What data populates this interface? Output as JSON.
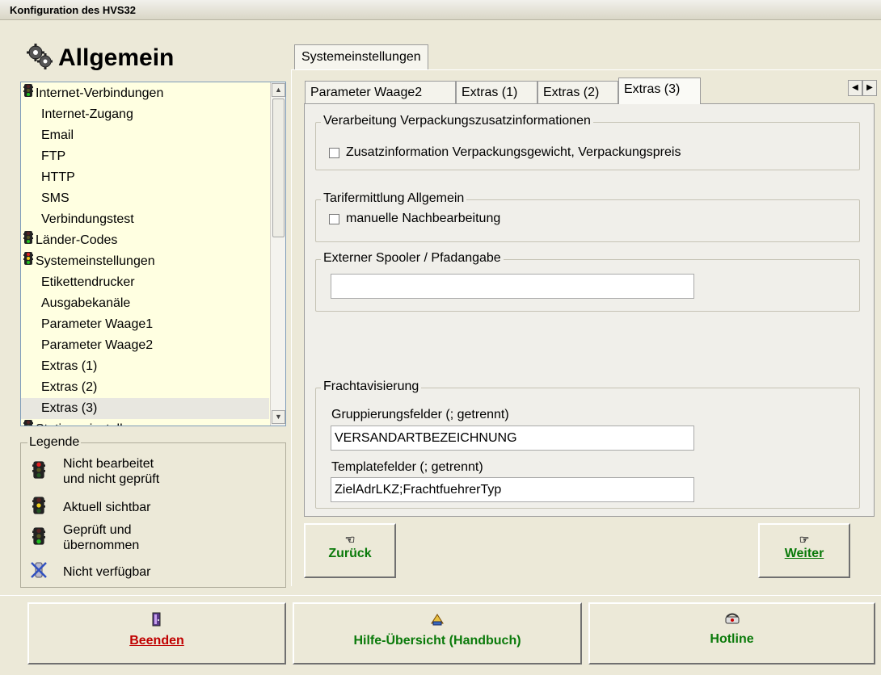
{
  "window": {
    "title": "Konfiguration des HVS32"
  },
  "left": {
    "heading": "Allgemein",
    "tree": [
      {
        "label": "Internet-Verbindungen",
        "level": 0,
        "icon": "traffic-light-icon"
      },
      {
        "label": "Internet-Zugang",
        "level": 1
      },
      {
        "label": "Email",
        "level": 1
      },
      {
        "label": "FTP",
        "level": 1
      },
      {
        "label": "HTTP",
        "level": 1
      },
      {
        "label": "SMS",
        "level": 1
      },
      {
        "label": "Verbindungstest",
        "level": 1
      },
      {
        "label": "Länder-Codes",
        "level": 0,
        "icon": "traffic-light-icon"
      },
      {
        "label": "Systemeinstellungen",
        "level": 0,
        "icon": "traffic-light-icon"
      },
      {
        "label": "Etikettendrucker",
        "level": 1
      },
      {
        "label": "Ausgabekanäle",
        "level": 1
      },
      {
        "label": "Parameter Waage1",
        "level": 1
      },
      {
        "label": "Parameter Waage2",
        "level": 1
      },
      {
        "label": "Extras (1)",
        "level": 1
      },
      {
        "label": "Extras (2)",
        "level": 1
      },
      {
        "label": "Extras (3)",
        "level": 1,
        "selected": true
      },
      {
        "label": "Stationseinstellungen",
        "level": 0,
        "icon": "traffic-light-icon"
      }
    ],
    "legend": {
      "title": "Legende",
      "items": [
        {
          "line1": "Nicht bearbeitet",
          "line2": "und nicht geprüft",
          "icon": "traffic-light-red-icon"
        },
        {
          "line1": "Aktuell sichtbar",
          "line2": "",
          "icon": "traffic-light-yellow-icon"
        },
        {
          "line1": "Geprüft und",
          "line2": "übernommen",
          "icon": "traffic-light-green-icon"
        },
        {
          "line1": "Nicht verfügbar",
          "line2": "",
          "icon": "not-available-icon"
        }
      ]
    }
  },
  "main": {
    "main_tab": "Systemeinstellungen",
    "sub_tabs": [
      "Parameter Waage2",
      "Extras (1)",
      "Extras (2)",
      "Extras (3)"
    ],
    "active_sub_tab": "Extras (3)",
    "groups": {
      "verpackung": {
        "title": "Verarbeitung Verpackungszusatzinformationen",
        "checkbox_label": "Zusatzinformation Verpackungsgewicht, Verpackungspreis",
        "checked": false
      },
      "tarif": {
        "title": "Tarifermittlung Allgemein",
        "checkbox_label": "manuelle Nachbearbeitung",
        "checked": false
      },
      "spooler": {
        "title": "Externer Spooler / Pfadangabe",
        "value": ""
      },
      "fracht": {
        "title": "Frachtavisierung",
        "gruppierung_label": "Gruppierungsfelder (; getrennt)",
        "gruppierung_value": "VERSANDARTBEZEICHNUNG",
        "template_label": "Templatefelder (; getrennt)",
        "template_value": "ZielAdrLKZ;FrachtfuehrerTyp"
      }
    },
    "nav": {
      "back": "Zurück",
      "next": "Weiter"
    }
  },
  "bottom": {
    "quit": "Beenden",
    "help": "Hilfe-Übersicht (Handbuch)",
    "hotline": "Hotline"
  },
  "colors": {
    "tree_bg": "#ffffe1",
    "green_text": "#0a7a0a",
    "red_text": "#c00000"
  }
}
